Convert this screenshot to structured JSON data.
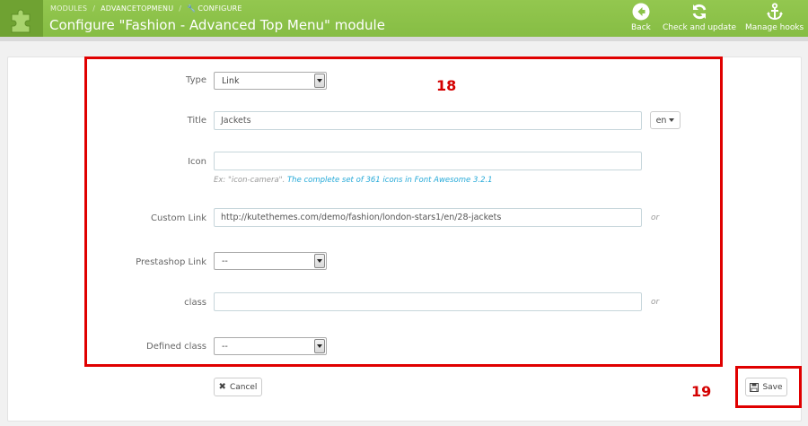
{
  "header": {
    "breadcrumb": [
      "MODULES",
      "ADVANCETOPMENU",
      "CONFIGURE"
    ],
    "title": "Configure \"Fashion - Advanced Top Menu\" module",
    "actions": [
      {
        "label": "Back",
        "icon": "back-icon"
      },
      {
        "label": "Check and update",
        "icon": "refresh-icon"
      },
      {
        "label": "Manage hooks",
        "icon": "anchor-icon"
      }
    ],
    "accent_color": "#8bc34a"
  },
  "form": {
    "type": {
      "label": "Type",
      "value": "Link"
    },
    "title": {
      "label": "Title",
      "value": "Jackets",
      "language": "en"
    },
    "icon": {
      "label": "Icon",
      "value": "",
      "help_prefix": "Ex: \"icon-camera\".",
      "help_link": "The complete set of 361 icons in Font Awesome 3.2.1"
    },
    "custom_link": {
      "label": "Custom Link",
      "value": "http://kutethemes.com/demo/fashion/london-stars1/en/28-jackets",
      "or": "or"
    },
    "prestashop_link": {
      "label": "Prestashop Link",
      "value": "--"
    },
    "class": {
      "label": "class",
      "value": "",
      "or": "or"
    },
    "defined_class": {
      "label": "Defined class",
      "value": "--"
    }
  },
  "buttons": {
    "cancel": "Cancel",
    "save": "Save"
  },
  "annotations": {
    "box18": "18",
    "box19": "19",
    "color": "#e00000"
  }
}
